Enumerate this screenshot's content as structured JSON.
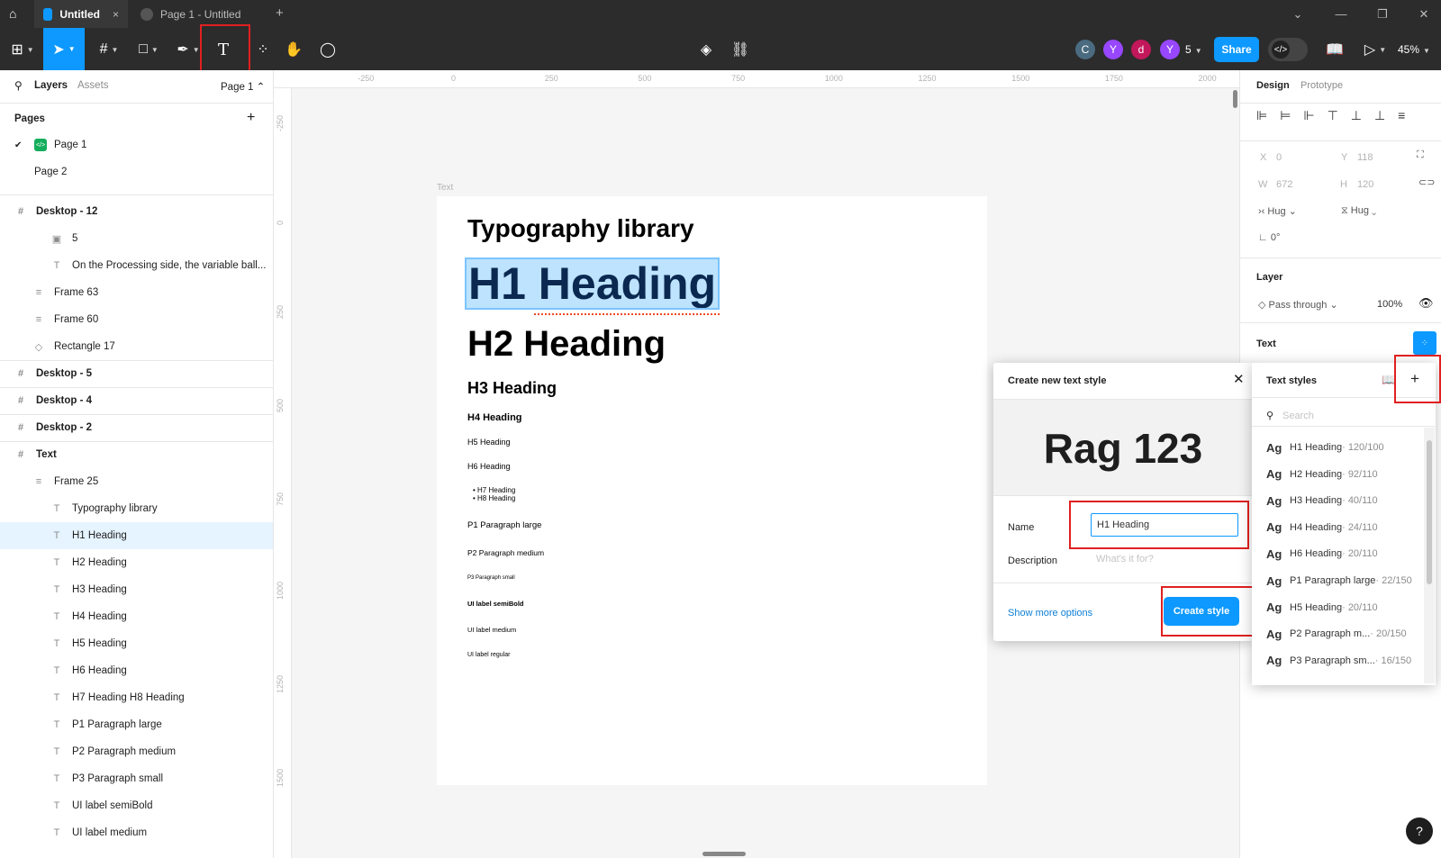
{
  "titlebar": {
    "tab1": "Untitled",
    "tab2": "Page 1 - Untitled",
    "close": "×",
    "plus": "+",
    "win": [
      "⌄",
      "—",
      "❐",
      "✕"
    ]
  },
  "toolbar": {
    "share": "Share",
    "zoom": "45%",
    "avatars": [
      {
        "l": "C",
        "c": "#4a7a9b"
      },
      {
        "l": "Y",
        "c": "#9747ff"
      },
      {
        "l": "d",
        "c": "#c2185b"
      },
      {
        "l": "Y",
        "c": "#9747ff"
      }
    ],
    "count": "5"
  },
  "left": {
    "tabs": [
      "Layers",
      "Assets"
    ],
    "page_sel": "Page 1 ⌃",
    "pages_title": "Pages",
    "pages": [
      "Page 1",
      "Page 2"
    ],
    "layers": [
      {
        "t": "Desktop - 12",
        "i": "#",
        "ind": 0
      },
      {
        "t": "5",
        "i": "▣",
        "ind": 2
      },
      {
        "t": "On the Processing side, the variable ball...",
        "i": "T",
        "ind": 2
      },
      {
        "t": "Frame 63",
        "i": "≡",
        "ind": 1
      },
      {
        "t": "Frame 60",
        "i": "≡",
        "ind": 1
      },
      {
        "t": "Rectangle 17",
        "i": "◇",
        "ind": 1
      },
      {
        "t": "Desktop - 5",
        "i": "#",
        "ind": 0
      },
      {
        "t": "Desktop - 4",
        "i": "#",
        "ind": 0
      },
      {
        "t": "Desktop - 2",
        "i": "#",
        "ind": 0
      },
      {
        "t": "Text",
        "i": "#",
        "ind": 0
      },
      {
        "t": "Frame 25",
        "i": "≡",
        "ind": 1
      },
      {
        "t": "Typography library",
        "i": "T",
        "ind": 2
      },
      {
        "t": "H1 Heading",
        "i": "T",
        "ind": 2,
        "sel": true
      },
      {
        "t": "H2 Heading",
        "i": "T",
        "ind": 2
      },
      {
        "t": "H3 Heading",
        "i": "T",
        "ind": 2
      },
      {
        "t": "H4 Heading",
        "i": "T",
        "ind": 2
      },
      {
        "t": "H5 Heading",
        "i": "T",
        "ind": 2
      },
      {
        "t": "H6 Heading",
        "i": "T",
        "ind": 2
      },
      {
        "t": "H7 Heading H8 Heading",
        "i": "T",
        "ind": 2
      },
      {
        "t": "P1 Paragraph large",
        "i": "T",
        "ind": 2
      },
      {
        "t": "P2 Paragraph medium",
        "i": "T",
        "ind": 2
      },
      {
        "t": "P3 Paragraph small",
        "i": "T",
        "ind": 2
      },
      {
        "t": "UI label semiBold",
        "i": "T",
        "ind": 2
      },
      {
        "t": "UI label medium",
        "i": "T",
        "ind": 2
      }
    ]
  },
  "canvas": {
    "ruler_top": [
      "-250",
      "0",
      "250",
      "500",
      "750",
      "1000",
      "1250",
      "1500",
      "1750",
      "2000"
    ],
    "ruler_left": [
      "-250",
      "0",
      "250",
      "500",
      "750",
      "1000",
      "1250",
      "1500"
    ],
    "frame_label": "Text",
    "frame": {
      "title": "Typography library",
      "h1": "H1 Heading",
      "h2": "H2 Heading",
      "h3": "H3 Heading",
      "h4": "H4 Heading",
      "h5": "H5 Heading",
      "h6": "H6 Heading",
      "h7": "H7 Heading",
      "h8": "H8 Heading",
      "p1": "P1 Paragraph large",
      "p2": "P2 Paragraph medium",
      "p3": "P3 Paragraph small",
      "ui1": "UI label semiBold",
      "ui2": "UI label medium",
      "ui3": "UI label regular"
    }
  },
  "right": {
    "tabs": [
      "Design",
      "Prototype"
    ],
    "x_label": "X",
    "x": "0",
    "y_label": "Y",
    "y": "118",
    "w_label": "W",
    "w": "672",
    "h_label": "H",
    "h": "120",
    "hug1": "Hug",
    "hug2": "Hug",
    "rot": "0°",
    "layer_title": "Layer",
    "blend": "Pass through",
    "opacity": "100%",
    "text_title": "Text"
  },
  "dialog": {
    "title": "Create new text style",
    "preview": "Rag 123",
    "name_label": "Name",
    "name_value": "H1 Heading",
    "desc_label": "Description",
    "desc_placeholder": "What's it for?",
    "more": "Show more options",
    "create": "Create style"
  },
  "styles": {
    "title": "Text styles",
    "search": "Search",
    "items": [
      {
        "n": "H1 Heading",
        "m": " · 120/100"
      },
      {
        "n": "H2 Heading",
        "m": " · 92/110"
      },
      {
        "n": "H3 Heading",
        "m": " · 40/110"
      },
      {
        "n": "H4 Heading",
        "m": " · 24/110"
      },
      {
        "n": "H6 Heading",
        "m": " · 20/110"
      },
      {
        "n": "P1 Paragraph large",
        "m": " · 22/150"
      },
      {
        "n": "H5 Heading",
        "m": " · 20/110"
      },
      {
        "n": "P2 Paragraph m...",
        "m": " · 20/150"
      },
      {
        "n": "P3 Paragraph sm...",
        "m": " · 16/150"
      }
    ],
    "ag": "Ag"
  },
  "help": "?"
}
